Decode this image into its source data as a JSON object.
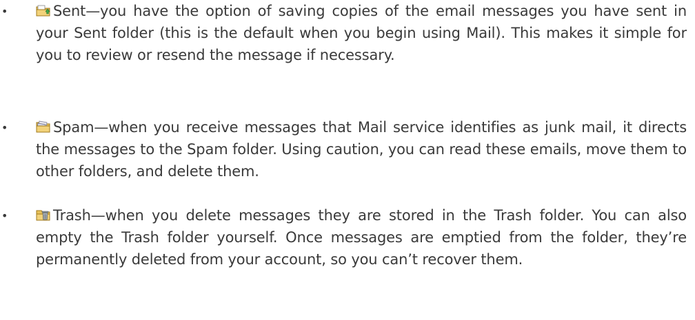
{
  "items": [
    {
      "bullet": "•",
      "icon": "sent-folder-icon",
      "lead": "Sent",
      "text": "—you have the option of saving copies of the email messages you have sent in your Sent folder (this is the default when you begin using Mail). This makes it simple for you to review or resend the message if necessary."
    },
    {
      "bullet": "•",
      "icon": "spam-folder-icon",
      "lead": "Spam",
      "text": "—when you receive messages that Mail service identifies as junk mail, it directs the messages to the Spam folder. Using caution, you can read these emails, move them to other folders, and delete them."
    },
    {
      "bullet": "•",
      "icon": "trash-folder-icon",
      "lead": "Trash",
      "text": "—when you delete messages they are stored in the Trash folder. You can also empty the Trash folder yourself. Once messages are emptied from the folder, they’re permanently deleted from your account, so you can’t recover them."
    }
  ]
}
